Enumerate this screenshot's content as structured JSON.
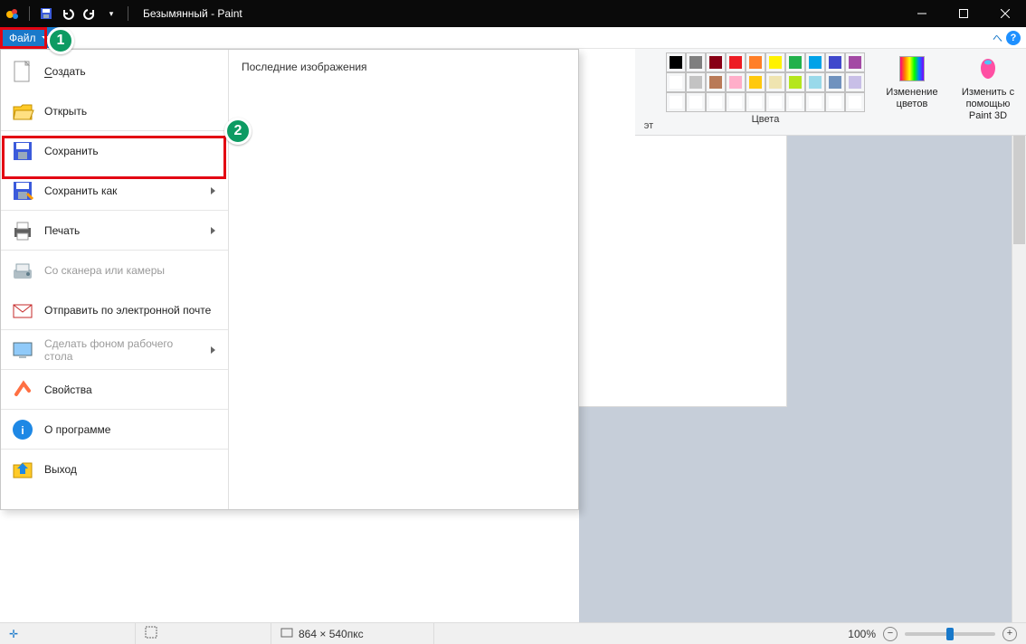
{
  "title": "Безымянный - Paint",
  "topstrip": {
    "file": "Файл"
  },
  "annotations": {
    "one": "1",
    "two": "2"
  },
  "ribbon": {
    "cut_label": "эт",
    "colors_label": "Цвета",
    "edit_colors": "Изменение\nцветов",
    "paint3d": "Изменить с\nпомощью Paint 3D",
    "row1": [
      "#000000",
      "#7f7f7f",
      "#880015",
      "#ed1c24",
      "#ff7f27",
      "#fff200",
      "#22b14c",
      "#00a2e8",
      "#3f48cc",
      "#a349a4"
    ],
    "row2": [
      "#ffffff",
      "#c3c3c3",
      "#b97a57",
      "#ffaec9",
      "#ffc90e",
      "#efe4b0",
      "#b5e61d",
      "#99d9ea",
      "#7092be",
      "#c8bfe7"
    ],
    "row3": [
      "#ffffff",
      "#ffffff",
      "#ffffff",
      "#ffffff",
      "#ffffff",
      "#ffffff",
      "#ffffff",
      "#ffffff",
      "#ffffff",
      "#ffffff"
    ]
  },
  "menu": {
    "recent_header": "Последние изображения",
    "items": [
      {
        "label": "Создать",
        "underline_first": true,
        "disabled": false,
        "submenu": false,
        "sep": false,
        "icon": "new"
      },
      {
        "label": "Открыть",
        "underline_first": false,
        "disabled": false,
        "submenu": false,
        "sep": true,
        "icon": "open"
      },
      {
        "label": "Сохранить",
        "underline_first": false,
        "disabled": false,
        "submenu": false,
        "sep": false,
        "icon": "save"
      },
      {
        "label": "Сохранить как",
        "underline_first": false,
        "disabled": false,
        "submenu": true,
        "sep": true,
        "icon": "saveas"
      },
      {
        "label": "Печать",
        "underline_first": false,
        "disabled": false,
        "submenu": true,
        "sep": true,
        "icon": "print"
      },
      {
        "label": "Со сканера или камеры",
        "underline_first": false,
        "disabled": true,
        "submenu": false,
        "sep": false,
        "icon": "scanner"
      },
      {
        "label": "Отправить по электронной почте",
        "underline_first": false,
        "disabled": false,
        "submenu": false,
        "sep": true,
        "icon": "mail"
      },
      {
        "label": "Сделать фоном рабочего стола",
        "underline_first": false,
        "disabled": true,
        "submenu": true,
        "sep": true,
        "icon": "desktop"
      },
      {
        "label": "Свойства",
        "underline_first": false,
        "disabled": false,
        "submenu": false,
        "sep": true,
        "icon": "props"
      },
      {
        "label": "О программе",
        "underline_first": false,
        "disabled": false,
        "submenu": false,
        "sep": true,
        "icon": "about"
      },
      {
        "label": "Выход",
        "underline_first": false,
        "disabled": false,
        "submenu": false,
        "sep": false,
        "icon": "exit"
      }
    ]
  },
  "status": {
    "dims": "864 × 540пкс",
    "zoom": "100%"
  }
}
